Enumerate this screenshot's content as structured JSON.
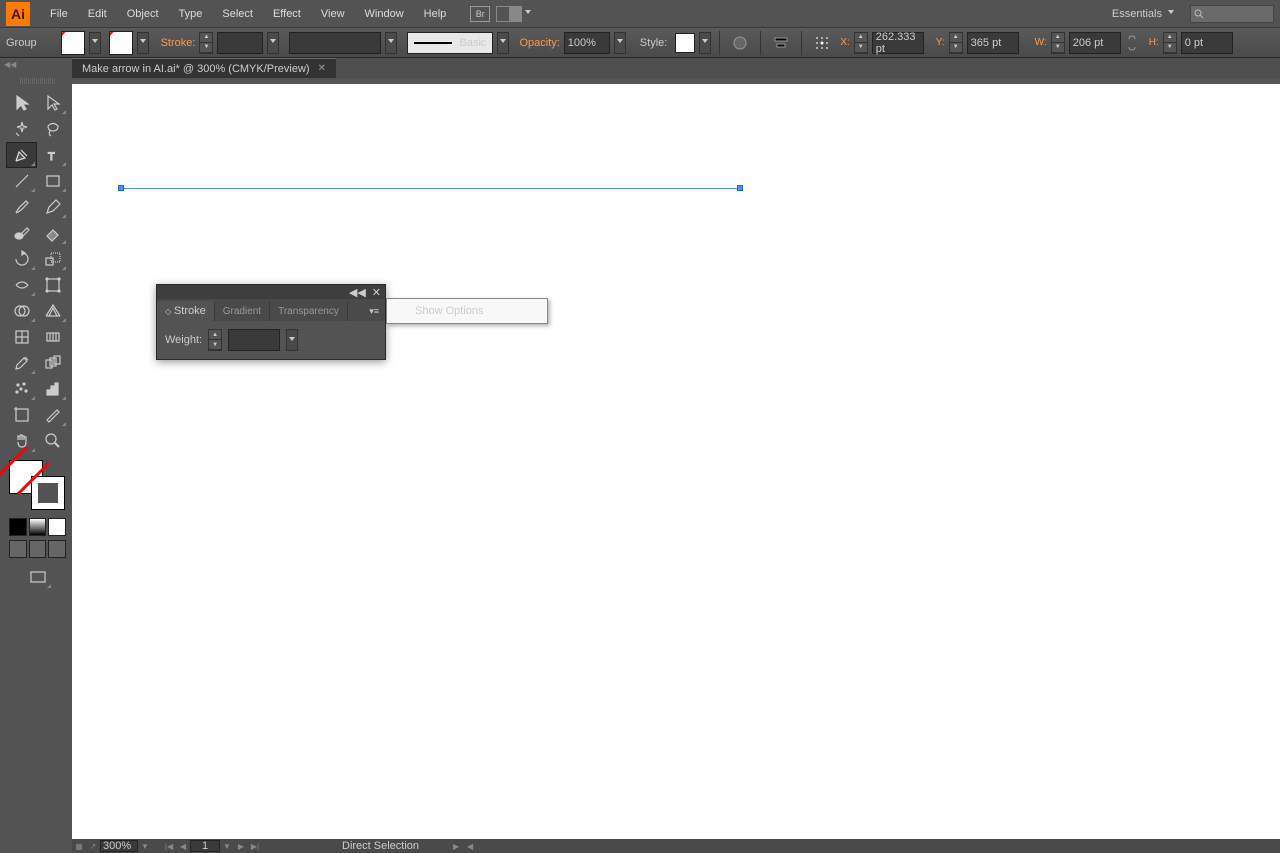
{
  "menubar": {
    "items": [
      "File",
      "Edit",
      "Object",
      "Type",
      "Select",
      "Effect",
      "View",
      "Window",
      "Help"
    ],
    "workspace": "Essentials"
  },
  "control": {
    "selection": "Group",
    "stroke_label": "Stroke:",
    "brush": "Basic",
    "opacity_label": "Opacity:",
    "opacity_value": "100%",
    "style_label": "Style:",
    "x_label": "X:",
    "x_value": "262.333 pt",
    "y_label": "Y:",
    "y_value": "365 pt",
    "w_label": "W:",
    "w_value": "206 pt",
    "h_label": "H:",
    "h_value": "0 pt"
  },
  "document": {
    "tab_title": "Make arrow in AI.ai* @ 300% (CMYK/Preview)"
  },
  "panel": {
    "tabs": [
      "Stroke",
      "Gradient",
      "Transparency"
    ],
    "weight_label": "Weight:"
  },
  "context_menu": {
    "item": "Show Options"
  },
  "status": {
    "zoom": "300%",
    "page": "1",
    "tool": "Direct Selection"
  }
}
